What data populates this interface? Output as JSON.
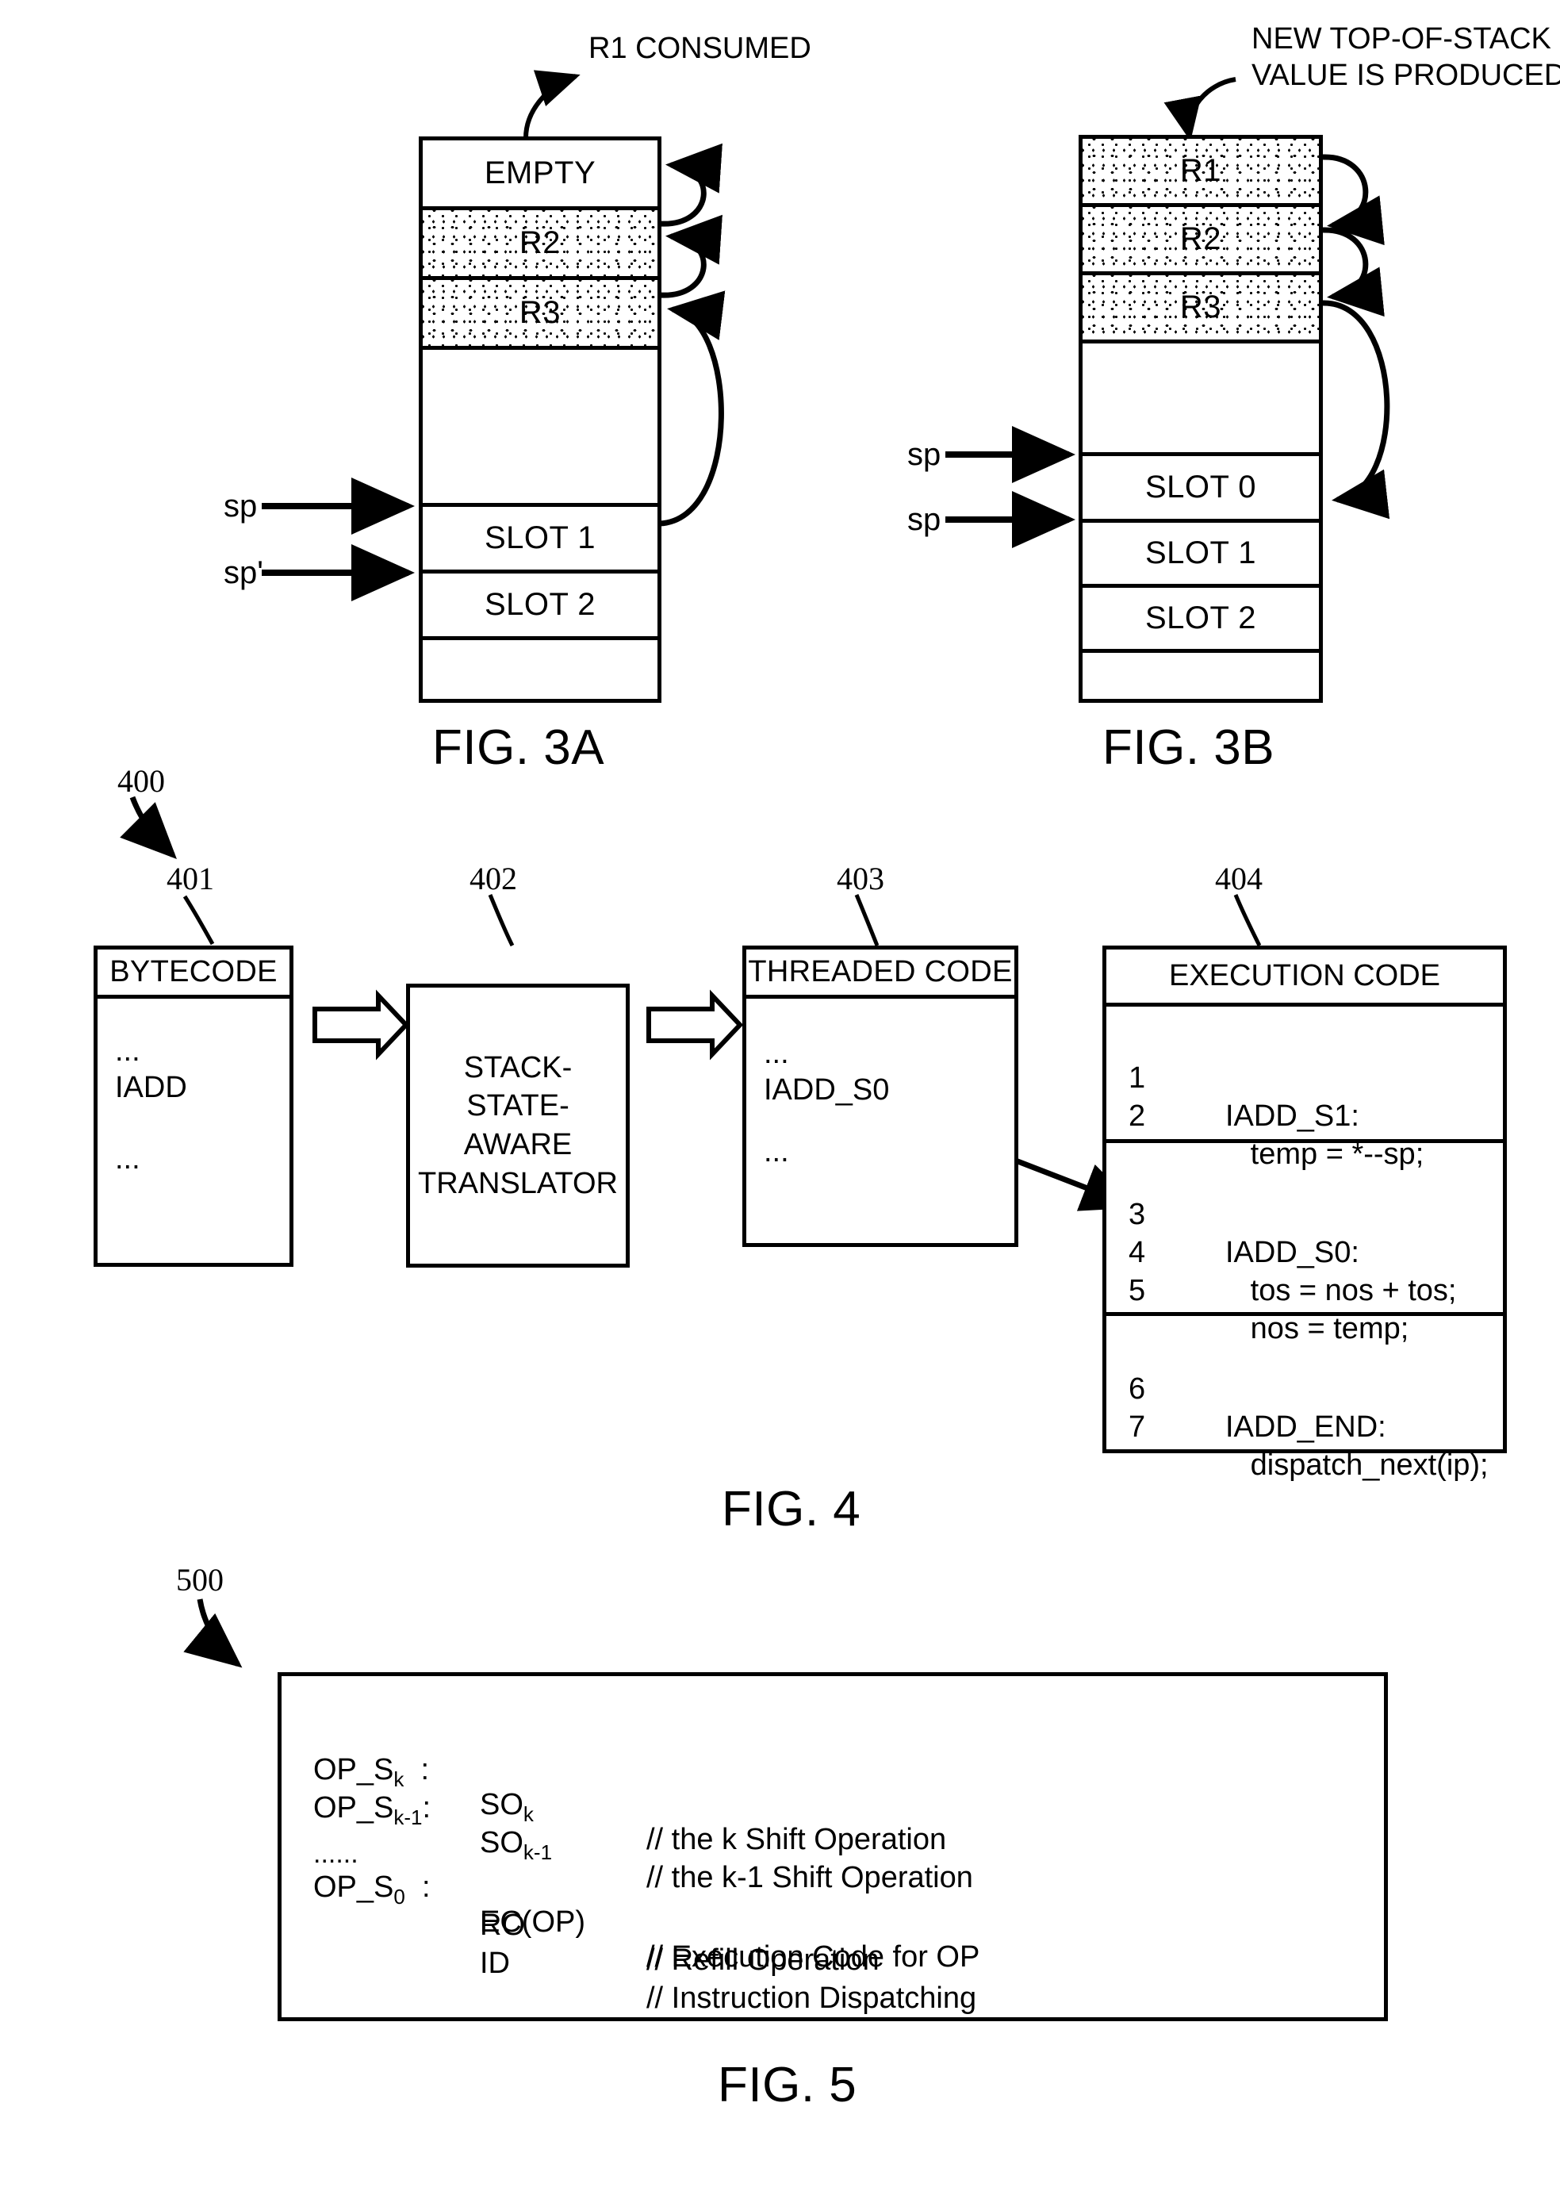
{
  "fig3a": {
    "annotation": "R1 CONSUMED",
    "pointer_labels": [
      "sp",
      "sp'"
    ],
    "rows": [
      {
        "label": "EMPTY",
        "shaded": false
      },
      {
        "label": "R2",
        "shaded": true
      },
      {
        "label": "R3",
        "shaded": true
      },
      {
        "label": "",
        "shaded": false
      },
      {
        "label": "SLOT 1",
        "shaded": false
      },
      {
        "label": "SLOT 2",
        "shaded": false
      },
      {
        "label": "",
        "shaded": false
      }
    ],
    "caption": "FIG. 3A"
  },
  "fig3b": {
    "annotation_line1": "NEW TOP-OF-STACK",
    "annotation_line2": "VALUE IS PRODUCED",
    "pointer_labels": [
      "sp",
      "sp"
    ],
    "rows": [
      {
        "label": "R1",
        "shaded": true
      },
      {
        "label": "R2",
        "shaded": true
      },
      {
        "label": "R3",
        "shaded": true
      },
      {
        "label": "",
        "shaded": false
      },
      {
        "label": "SLOT 0",
        "shaded": false
      },
      {
        "label": "SLOT 1",
        "shaded": false
      },
      {
        "label": "SLOT 2",
        "shaded": false
      },
      {
        "label": "",
        "shaded": false
      }
    ],
    "caption": "FIG. 3B"
  },
  "fig4": {
    "caption": "FIG. 4",
    "diagram_ref": "400",
    "bytecode": {
      "ref": "401",
      "header": "BYTECODE",
      "lines": [
        "...",
        "IADD",
        "..."
      ]
    },
    "translator": {
      "ref": "402",
      "lines": [
        "STACK-",
        "STATE-",
        "AWARE",
        "TRANSLATOR"
      ]
    },
    "threaded": {
      "ref": "403",
      "header": "THREADED CODE",
      "lines": [
        "...",
        "IADD_S0",
        "..."
      ]
    },
    "execution": {
      "ref": "404",
      "header": "EXECUTION CODE",
      "groups": [
        {
          "lines": [
            {
              "num": "1",
              "code": "IADD_S1:"
            },
            {
              "num": "2",
              "code": "   temp = *--sp;"
            }
          ]
        },
        {
          "lines": [
            {
              "num": "3",
              "code": "IADD_S0:"
            },
            {
              "num": "4",
              "code": "   tos = nos + tos;"
            },
            {
              "num": "5",
              "code": "   nos = temp;"
            }
          ]
        },
        {
          "lines": [
            {
              "num": "6",
              "code": "IADD_END:"
            },
            {
              "num": "7",
              "code": "   dispatch_next(ip);"
            }
          ]
        }
      ]
    }
  },
  "fig5": {
    "caption": "FIG. 5",
    "diagram_ref": "500",
    "rows": [
      {
        "lhs": "OP_S",
        "lhs_sub": "k",
        "lhs_tail": "  :",
        "mid": "SO",
        "mid_sub": "k",
        "mid_tail": "",
        "comment": "// the k Shift Operation"
      },
      {
        "lhs": "OP_S",
        "lhs_sub": "k-1",
        "lhs_tail": ":",
        "mid": "SO",
        "mid_sub": "k-1",
        "mid_tail": "",
        "comment": "// the k-1 Shift Operation"
      },
      {
        "lhs": "......",
        "lhs_sub": "",
        "lhs_tail": "",
        "mid": "",
        "mid_sub": "",
        "mid_tail": "",
        "comment": ""
      },
      {
        "lhs": "OP_S",
        "lhs_sub": "0",
        "lhs_tail": "  :",
        "mid": "EC(OP)",
        "mid_sub": "",
        "mid_tail": "",
        "comment": "// Execution Code for OP"
      },
      {
        "lhs": "",
        "lhs_sub": "",
        "lhs_tail": "",
        "mid": "RO",
        "mid_sub": "",
        "mid_tail": "",
        "comment": "// Refill Operation"
      },
      {
        "lhs": "",
        "lhs_sub": "",
        "lhs_tail": "",
        "mid": "ID",
        "mid_sub": "",
        "mid_tail": "",
        "comment": "// Instruction Dispatching"
      }
    ]
  },
  "colors": {
    "ink": "#000000",
    "paper": "#ffffff"
  }
}
